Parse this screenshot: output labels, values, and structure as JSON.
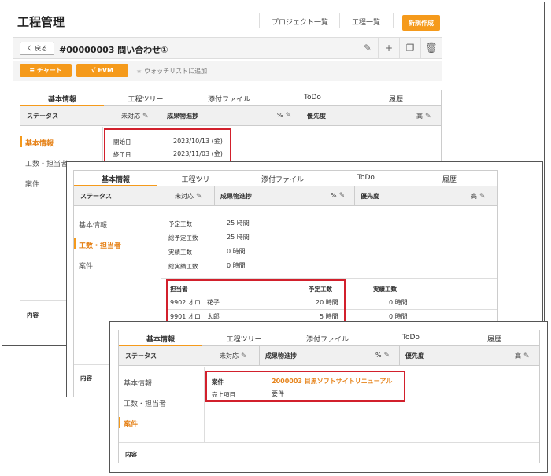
{
  "window1": {
    "app_title": "工程管理",
    "nav": [
      "プロジェクト一覧",
      "工程一覧"
    ],
    "new_button": "新規作成",
    "back_button": "く 戻る",
    "issue_title": "#00000003 問い合わせ①",
    "chart_button": "チャート",
    "evm_button": "EVM",
    "watch_label": "ウォッチリストに追加",
    "tabs": [
      "基本情報",
      "工程ツリー",
      "添付ファイル",
      "ToDo",
      "履歴"
    ],
    "status": {
      "label": "ステータス",
      "value": "未対応",
      "progress_label": "成果物進捗",
      "progress_value": "%",
      "priority_label": "優先度",
      "priority_value": "高"
    },
    "side_nav": [
      "基本情報",
      "工数・担当者",
      "案件"
    ],
    "dates": [
      {
        "label": "開始日",
        "value": "2023/10/13 (金)"
      },
      {
        "label": "終了日",
        "value": "2023/11/03 (金)"
      }
    ],
    "content_label": "内容"
  },
  "window2": {
    "tabs": [
      "基本情報",
      "工程ツリー",
      "添付ファイル",
      "ToDo",
      "履歴"
    ],
    "status": {
      "label": "ステータス",
      "value": "未対応",
      "progress_label": "成果物進捗",
      "progress_value": "%",
      "priority_label": "優先度",
      "priority_value": "高"
    },
    "side_nav": [
      "基本情報",
      "工数・担当者",
      "案件"
    ],
    "effort": [
      {
        "label": "予定工数",
        "value": "25 時間"
      },
      {
        "label": "総予定工数",
        "value": "25 時間"
      },
      {
        "label": "実績工数",
        "value": "0 時間"
      },
      {
        "label": "総実績工数",
        "value": "0 時間"
      }
    ],
    "assignee_headers": [
      "担当者",
      "予定工数",
      "実績工数"
    ],
    "assignees": [
      {
        "name": "9902 オロ　花子",
        "planned": "20 時間",
        "actual": "0 時間"
      },
      {
        "name": "9901 オロ　太郎",
        "planned": "5 時間",
        "actual": "0 時間"
      }
    ],
    "content_label": "内容"
  },
  "window3": {
    "tabs": [
      "基本情報",
      "工程ツリー",
      "添付ファイル",
      "ToDo",
      "履歴"
    ],
    "status": {
      "label": "ステータス",
      "value": "未対応",
      "progress_label": "成果物進捗",
      "progress_value": "%",
      "priority_label": "優先度",
      "priority_value": "高"
    },
    "side_nav": [
      "基本情報",
      "工数・担当者",
      "案件"
    ],
    "project": {
      "label": "案件",
      "value": "2000003 目黒ソフトサイトリニューアル"
    },
    "sales": {
      "label": "売上項目",
      "value": "要件"
    },
    "content_label": "内容"
  },
  "colors": {
    "accent": "#f59a1b",
    "highlight": "#d2202c"
  }
}
